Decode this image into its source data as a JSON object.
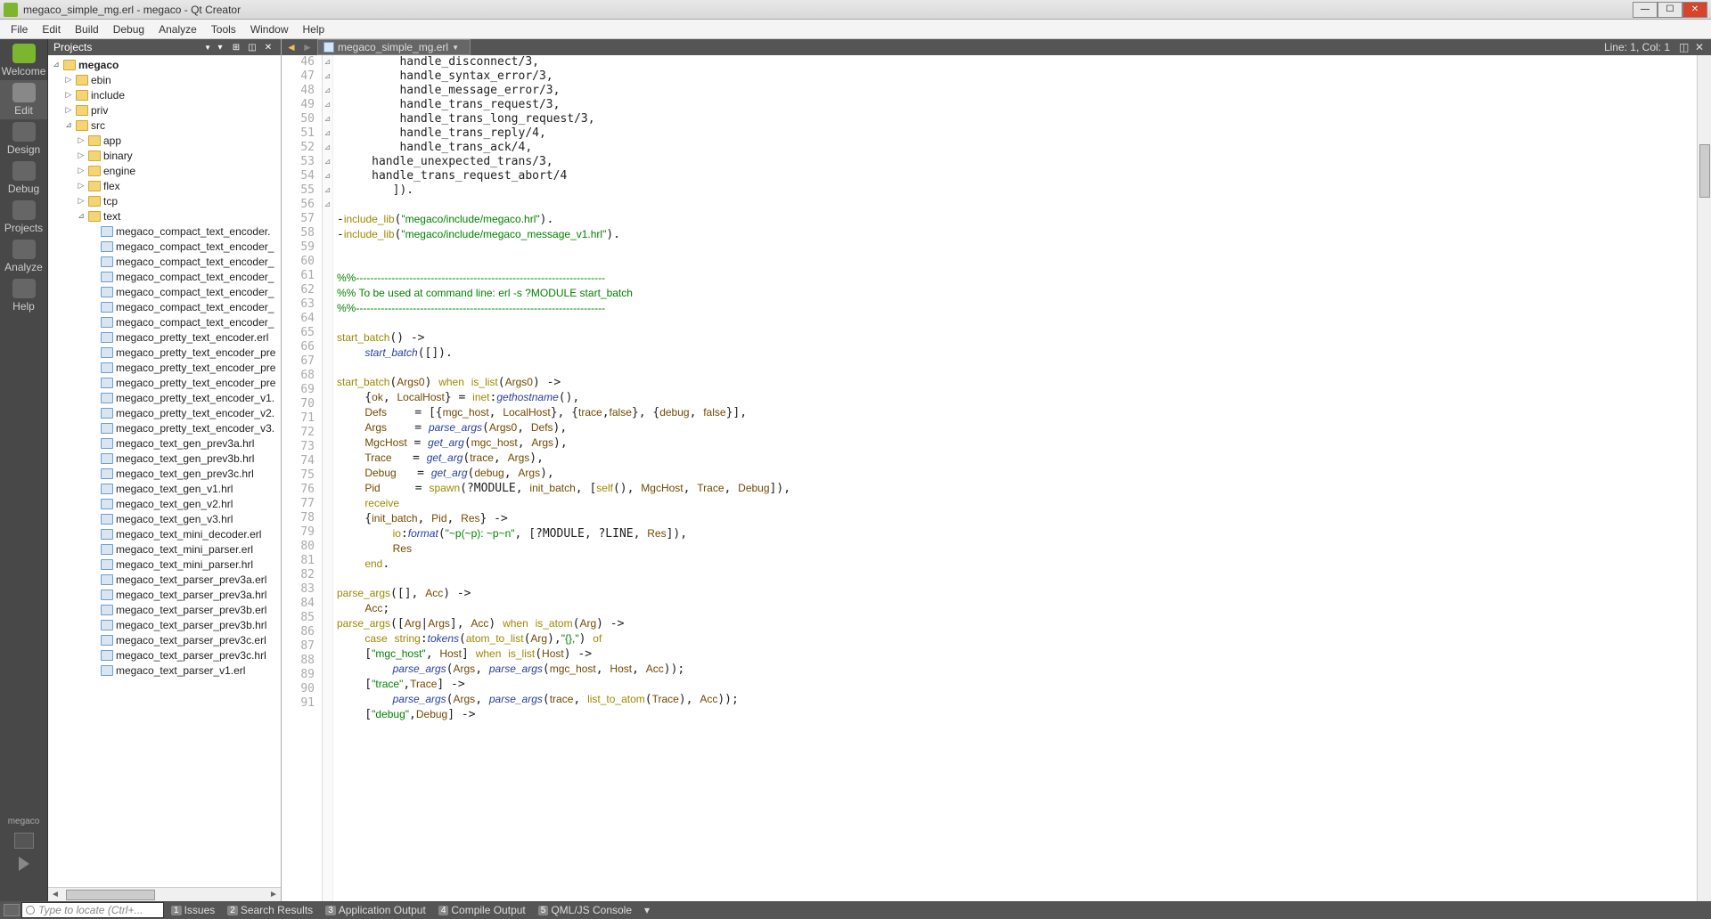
{
  "window": {
    "title": "megaco_simple_mg.erl - megaco - Qt Creator"
  },
  "menu": [
    "File",
    "Edit",
    "Build",
    "Debug",
    "Analyze",
    "Tools",
    "Window",
    "Help"
  ],
  "modes": [
    {
      "label": "Welcome",
      "icon": "welcome"
    },
    {
      "label": "Edit",
      "icon": "edit",
      "active": true
    },
    {
      "label": "Design",
      "icon": "design"
    },
    {
      "label": "Debug",
      "icon": "debug"
    },
    {
      "label": "Projects",
      "icon": "projects"
    },
    {
      "label": "Analyze",
      "icon": "analyze"
    },
    {
      "label": "Help",
      "icon": "help"
    }
  ],
  "kit_label": "megaco",
  "projects_header": "Projects",
  "tree": {
    "root": "megaco",
    "folders": [
      "ebin",
      "include",
      "priv",
      "src"
    ],
    "src_subfolders": [
      "app",
      "binary",
      "engine",
      "flex",
      "tcp",
      "text"
    ],
    "text_files": [
      "megaco_compact_text_encoder.",
      "megaco_compact_text_encoder_",
      "megaco_compact_text_encoder_",
      "megaco_compact_text_encoder_",
      "megaco_compact_text_encoder_",
      "megaco_compact_text_encoder_",
      "megaco_compact_text_encoder_",
      "megaco_pretty_text_encoder.erl",
      "megaco_pretty_text_encoder_pre",
      "megaco_pretty_text_encoder_pre",
      "megaco_pretty_text_encoder_pre",
      "megaco_pretty_text_encoder_v1.",
      "megaco_pretty_text_encoder_v2.",
      "megaco_pretty_text_encoder_v3.",
      "megaco_text_gen_prev3a.hrl",
      "megaco_text_gen_prev3b.hrl",
      "megaco_text_gen_prev3c.hrl",
      "megaco_text_gen_v1.hrl",
      "megaco_text_gen_v2.hrl",
      "megaco_text_gen_v3.hrl",
      "megaco_text_mini_decoder.erl",
      "megaco_text_mini_parser.erl",
      "megaco_text_mini_parser.hrl",
      "megaco_text_parser_prev3a.erl",
      "megaco_text_parser_prev3a.hrl",
      "megaco_text_parser_prev3b.erl",
      "megaco_text_parser_prev3b.hrl",
      "megaco_text_parser_prev3c.erl",
      "megaco_text_parser_prev3c.hrl",
      "megaco_text_parser_v1.erl"
    ]
  },
  "editor": {
    "filename": "megaco_simple_mg.erl",
    "position": "Line: 1, Col: 1",
    "first_line": 46,
    "fold_markers": {
      "62": "⊿",
      "66": "⊿",
      "69": "⊿",
      "77": "⊿",
      "78": "⊿",
      "83": "⊿",
      "85": "⊿",
      "86": "⊿",
      "87": "⊿",
      "89": "⊿",
      "91": "⊿"
    }
  },
  "bottom": {
    "search_placeholder": "Type to locate (Ctrl+...",
    "tabs": [
      {
        "num": "1",
        "label": "Issues"
      },
      {
        "num": "2",
        "label": "Search Results"
      },
      {
        "num": "3",
        "label": "Application Output"
      },
      {
        "num": "4",
        "label": "Compile Output"
      },
      {
        "num": "5",
        "label": "QML/JS Console"
      }
    ]
  }
}
